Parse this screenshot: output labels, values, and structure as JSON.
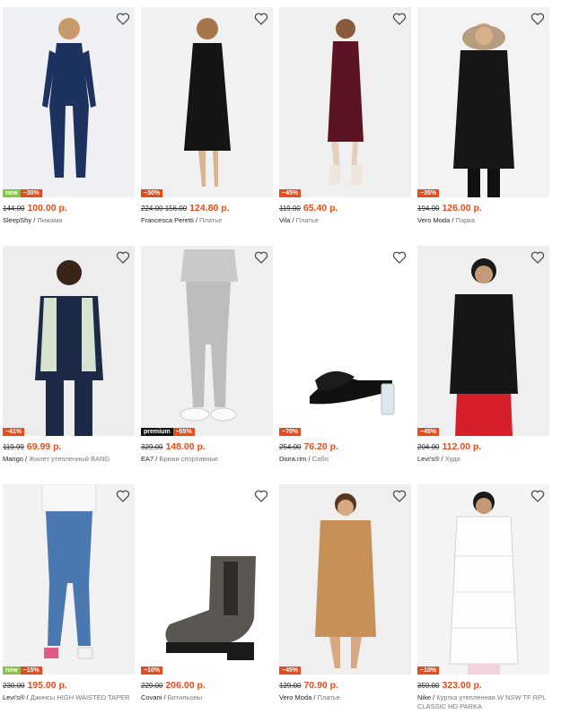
{
  "products": [
    {
      "brand": "SleepShy",
      "category": "Пижама",
      "old_price": "144.00",
      "price": "100.00 р.",
      "badge_new": "new",
      "badge_premium": "",
      "discount": "−30%",
      "photo_bg": "#eef0f3",
      "icon": "heart-icon"
    },
    {
      "brand": "Francesca Peretti",
      "category": "Платье",
      "old_price": "224.00 156.00",
      "price": "124.80 р.",
      "badge_new": "",
      "badge_premium": "",
      "discount": "−30%",
      "photo_bg": "#f1f1f1",
      "icon": "heart-icon"
    },
    {
      "brand": "Vila",
      "category": "Платье",
      "old_price": "119.00",
      "price": "65.40 р.",
      "badge_new": "",
      "badge_premium": "",
      "discount": "−45%",
      "photo_bg": "#f0f0f0",
      "icon": "heart-icon"
    },
    {
      "brand": "Vero Moda",
      "category": "Парка",
      "old_price": "194.00",
      "price": "126.00 р.",
      "badge_new": "",
      "badge_premium": "",
      "discount": "−35%",
      "photo_bg": "#f3f3f3",
      "icon": "heart-icon"
    },
    {
      "brand": "Mango",
      "category": "Жилет утепленный BANG",
      "old_price": "119.99",
      "price": "69.99 р.",
      "badge_new": "",
      "badge_premium": "",
      "discount": "−41%",
      "photo_bg": "#ededed",
      "icon": "heart-icon"
    },
    {
      "brand": "EA7",
      "category": "Брюки спортивные",
      "old_price": "329.00",
      "price": "148.00 р.",
      "badge_new": "",
      "badge_premium": "premium",
      "discount": "−55%",
      "photo_bg": "#f0f0f0",
      "icon": "heart-icon"
    },
    {
      "brand": "Diora.rim",
      "category": "Сабо",
      "old_price": "254.00",
      "price": "76.20 р.",
      "badge_new": "",
      "badge_premium": "",
      "discount": "−70%",
      "photo_bg": "#ffffff",
      "icon": "heart-icon"
    },
    {
      "brand": "Levi's®",
      "category": "Худи",
      "old_price": "204.00",
      "price": "112.00 р.",
      "badge_new": "",
      "badge_premium": "",
      "discount": "−45%",
      "photo_bg": "#efefef",
      "icon": "heart-icon"
    },
    {
      "brand": "Levi's®",
      "category": "Джинсы HIGH WAISTED TAPER",
      "old_price": "230.00",
      "price": "195.00 р.",
      "badge_new": "new",
      "badge_premium": "",
      "discount": "−15%",
      "photo_bg": "#f2f2f2",
      "icon": "heart-icon"
    },
    {
      "brand": "Covani",
      "category": "Ботильоны",
      "old_price": "229.00",
      "price": "206.00 р.",
      "badge_new": "",
      "badge_premium": "",
      "discount": "−10%",
      "photo_bg": "#ffffff",
      "icon": "heart-icon"
    },
    {
      "brand": "Vero Moda",
      "category": "Платье",
      "old_price": "129.00",
      "price": "70.90 р.",
      "badge_new": "",
      "badge_premium": "",
      "discount": "−45%",
      "photo_bg": "#efefef",
      "icon": "heart-icon"
    },
    {
      "brand": "Nike",
      "category": "Куртка утепленная W NSW TF RPL CLASSIC HD PARKA",
      "old_price": "359.00",
      "price": "323.00 р.",
      "badge_new": "",
      "badge_premium": "",
      "discount": "−10%",
      "photo_bg": "#f4f4f4",
      "icon": "heart-icon"
    }
  ],
  "colors": {
    "discount": "#e74c1a",
    "new_badge": "#8bc34a",
    "premium_badge": "#111111"
  }
}
